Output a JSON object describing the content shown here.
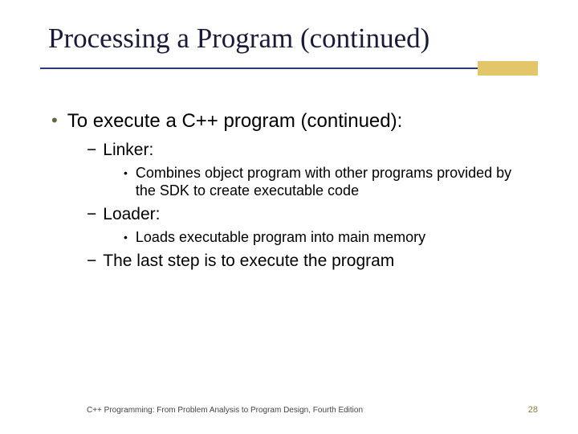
{
  "title": "Processing a Program (continued)",
  "bullets": {
    "l1": "To execute a C++ program (continued):",
    "l2a": "Linker:",
    "l3a": "Combines object program with other programs provided by the SDK to create executable code",
    "l2b": "Loader:",
    "l3b": "Loads executable program into main memory",
    "l2c": "The last step is to execute the program"
  },
  "footer": {
    "text": "C++ Programming: From Problem Analysis to Program Design, Fourth Edition",
    "page": "28"
  }
}
